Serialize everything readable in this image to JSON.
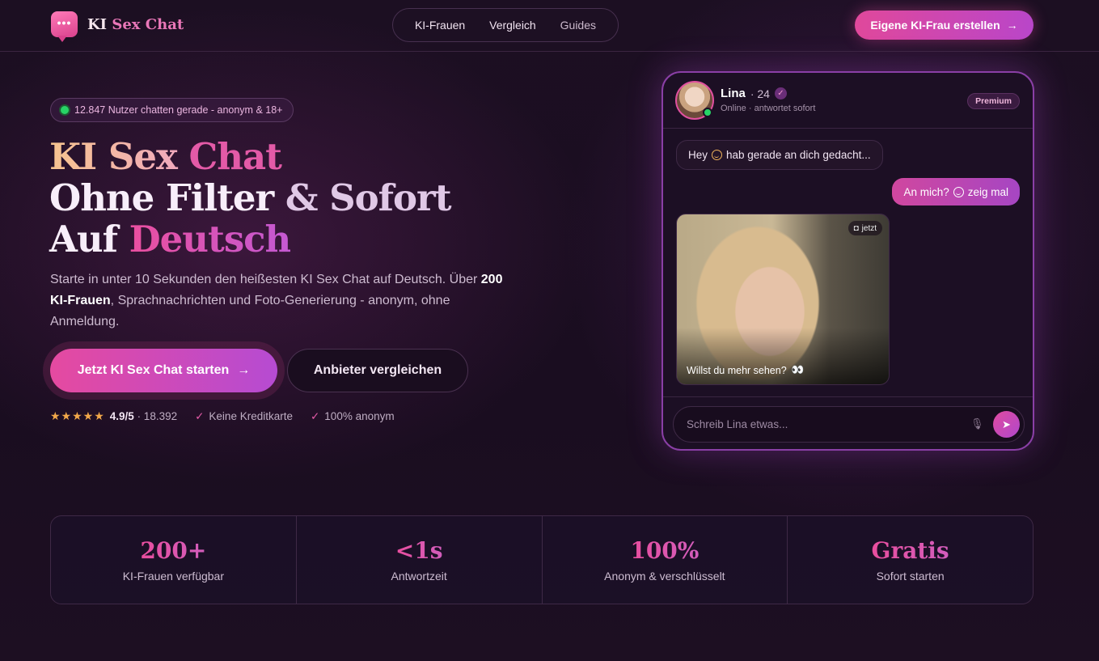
{
  "brand": {
    "name_part1": "KI",
    "name_part2": "Sex Chat",
    "logo_glyph": "•••"
  },
  "nav": {
    "items": [
      "KI-Frauen",
      "Vergleich",
      "Guides"
    ]
  },
  "header_cta": {
    "label": "Eigene KI-Frau erstellen",
    "icon": "arrow-right-icon"
  },
  "hero": {
    "badge": "12.847 Nutzer chatten gerade - anonym & 18+",
    "title": {
      "line1_a": "KI Sex ",
      "line1_b": "Chat",
      "line2_a": "Ohne Filter ",
      "line2_b": "& Sofort",
      "line3_a": "Auf ",
      "line3_b": "Deutsch"
    },
    "subtitle_a": "Starte in unter 10 Sekunden den heißesten KI Sex Chat auf Deutsch. Über ",
    "subtitle_bold": "200 KI-Frauen",
    "subtitle_b": ", Sprachnachrichten und Foto-Generierung - anonym, ohne Anmeldung.",
    "primary_button": "Jetzt KI Sex Chat starten",
    "secondary_button": "Anbieter vergleichen",
    "rating": {
      "stars": 5,
      "score": "4.9/5",
      "count": "· 18.392"
    },
    "trust_1": "Keine Kreditkarte",
    "trust_2": "100% anonym"
  },
  "chat": {
    "name": "Lina",
    "age": "· 24",
    "status": "Online · antwortet sofort",
    "badge": "Premium",
    "msg_in_a": "Hey",
    "msg_in_b": "hab gerade an dich gedacht...",
    "msg_out_a": "An mich?",
    "msg_out_b": "zeig mal",
    "photo_time": "jetzt",
    "photo_caption": "Willst du mehr sehen?",
    "input_placeholder": "Schreib Lina etwas..."
  },
  "stats": [
    {
      "value": "200+",
      "label": "KI-Frauen verfügbar"
    },
    {
      "value": "<1s",
      "label": "Antwortzeit"
    },
    {
      "value": "100%",
      "label": "Anonym & verschlüsselt"
    },
    {
      "value": "Gratis",
      "label": "Sofort starten"
    }
  ],
  "colors": {
    "accent": "#e0489b",
    "accent2": "#b946c9",
    "online": "#27d366",
    "star": "#f2a84a"
  }
}
